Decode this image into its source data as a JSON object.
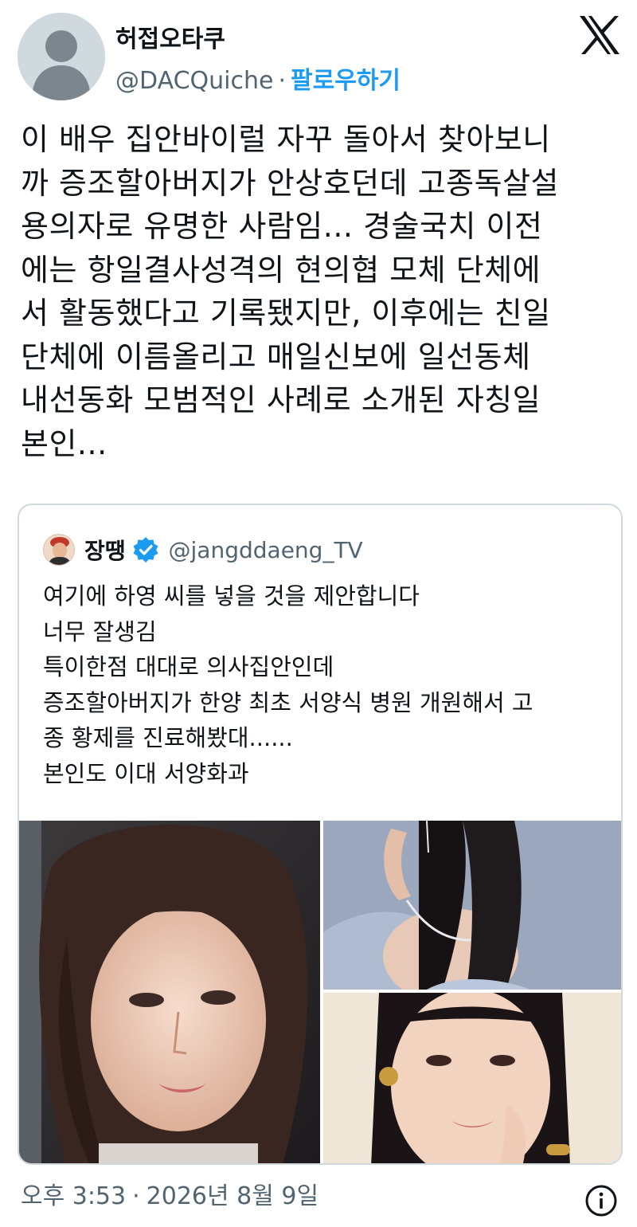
{
  "author": {
    "name": "허접오타쿠",
    "handle": "@DACQuiche",
    "separator": "·",
    "follow_label": "팔로우하기"
  },
  "tweet": {
    "text": "이 배우 집안바이럴 자꾸 돌아서 찾아보니\n까 증조할아버지가 안상호던데 고종독살설\n용의자로 유명한 사람임... 경술국치 이전\n에는 항일결사성격의 현의협 모체 단체에\n서 활동했다고 기록됐지만, 이후에는 친일\n단체에 이름올리고 매일신보에 일선동체\n내선동화 모범적인 사례로 소개된 자칭일\n본인..."
  },
  "quote": {
    "name": "장땡",
    "handle": "@jangddaeng_TV",
    "text": "여기에 하영 씨를 넣을 것을 제안합니다\n너무 잘생김\n특이한점 대대로 의사집안인데\n증조할아버지가 한양 최초 서양식 병원 개원해서 고\n종 황제를 진료해봤대......\n본인도 이대 서양화과"
  },
  "footer": {
    "time": "오후 3:53",
    "separator": "·",
    "date": "2026년 8월 9일"
  },
  "icons": {
    "logo": "x-logo-icon",
    "verified": "verified-badge-icon",
    "info": "info-icon"
  },
  "colors": {
    "accent": "#1d9bf0",
    "secondary_text": "#536471",
    "border": "#cfd9de"
  }
}
